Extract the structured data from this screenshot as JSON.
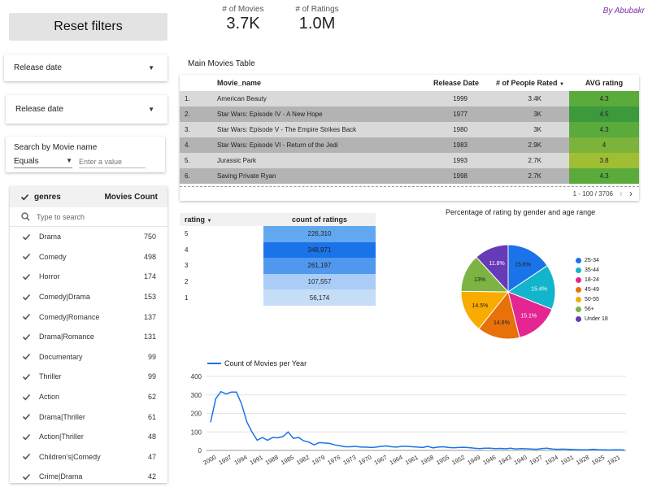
{
  "header": {
    "reset_label": "Reset filters",
    "author": "By Abubakr",
    "kpis": [
      {
        "label": "# of Movies",
        "value": "3.7K"
      },
      {
        "label": "# of Ratings",
        "value": "1.0M"
      }
    ]
  },
  "filters": {
    "release_date_1": "Release date",
    "release_date_2": "Release date",
    "search": {
      "title": "Search by Movie name",
      "operator": "Equals",
      "placeholder": "Enter a value"
    }
  },
  "genres": {
    "col_name": "genres",
    "col_count": "Movies Count",
    "search_placeholder": "Type to search",
    "items": [
      {
        "label": "Drama",
        "count": "750"
      },
      {
        "label": "Comedy",
        "count": "498"
      },
      {
        "label": "Horror",
        "count": "174"
      },
      {
        "label": "Comedy|Drama",
        "count": "153"
      },
      {
        "label": "Comedy|Romance",
        "count": "137"
      },
      {
        "label": "Drama|Romance",
        "count": "131"
      },
      {
        "label": "Documentary",
        "count": "99"
      },
      {
        "label": "Thriller",
        "count": "99"
      },
      {
        "label": "Action",
        "count": "62"
      },
      {
        "label": "Drama|Thriller",
        "count": "61"
      },
      {
        "label": "Action|Thriller",
        "count": "48"
      },
      {
        "label": "Children's|Comedy",
        "count": "47"
      },
      {
        "label": "Crime|Drama",
        "count": "42"
      }
    ]
  },
  "main_table": {
    "title": "Main Movies Table",
    "columns": [
      "Movie_name",
      "Release Date",
      "# of People Rated",
      "AVG rating"
    ],
    "rows": [
      {
        "idx": "1.",
        "name": "American Beauty",
        "year": "1999",
        "rated": "3.4K",
        "avg": "4.3",
        "color": "#5aaa3c"
      },
      {
        "idx": "2.",
        "name": "Star Wars: Episode IV - A New Hope",
        "year": "1977",
        "rated": "3K",
        "avg": "4.5",
        "color": "#3c9a3c"
      },
      {
        "idx": "3.",
        "name": "Star Wars: Episode V - The Empire Strikes Back",
        "year": "1980",
        "rated": "3K",
        "avg": "4.3",
        "color": "#5aaa3c"
      },
      {
        "idx": "4.",
        "name": "Star Wars: Episode VI - Return of the Jedi",
        "year": "1983",
        "rated": "2.9K",
        "avg": "4",
        "color": "#7cb33a"
      },
      {
        "idx": "5.",
        "name": "Jurassic Park",
        "year": "1993",
        "rated": "2.7K",
        "avg": "3.8",
        "color": "#9fbe33"
      },
      {
        "idx": "6.",
        "name": "Saving Private Ryan",
        "year": "1998",
        "rated": "2.7K",
        "avg": "4.3",
        "color": "#5aaa3c"
      }
    ],
    "pager": "1 - 100 / 3706"
  },
  "ratings_table": {
    "columns": [
      "rating",
      "count of ratings"
    ],
    "rows": [
      {
        "rating": "5",
        "count": "226,310",
        "color": "#62a8f0"
      },
      {
        "rating": "4",
        "count": "348,971",
        "color": "#1a73e8"
      },
      {
        "rating": "3",
        "count": "261,197",
        "color": "#4f98ee"
      },
      {
        "rating": "2",
        "count": "107,557",
        "color": "#a9cdf6"
      },
      {
        "rating": "1",
        "count": "56,174",
        "color": "#c6ddf8"
      }
    ]
  },
  "pie_chart": {
    "title": "Percentage of rating by gender and age range"
  },
  "line_chart": {
    "legend": "Count of Movies per Year"
  },
  "chart_data": [
    {
      "type": "pie",
      "title": "Percentage of rating by gender and age range",
      "labels": [
        "25-34",
        "35-44",
        "18-24",
        "45-49",
        "50-55",
        "56+",
        "Under 18"
      ],
      "values": [
        15.6,
        15.4,
        15.1,
        14.6,
        14.5,
        13,
        11.8
      ],
      "slice_labels": [
        "15.6%",
        "15.4%",
        "15.1%",
        "14.6%",
        "14.5%",
        "13%",
        "11.8%"
      ],
      "colors": [
        "#1a73e8",
        "#12b5cb",
        "#e52592",
        "#e8710a",
        "#f9ab00",
        "#7cb342",
        "#673ab7"
      ],
      "legend_position": "right"
    },
    {
      "type": "line",
      "series": [
        {
          "name": "Count of Movies per Year",
          "color": "#1a73e8",
          "values": [
            152,
            280,
            318,
            305,
            315,
            315,
            250,
            155,
            100,
            55,
            70,
            55,
            70,
            68,
            75,
            100,
            65,
            70,
            52,
            45,
            30,
            42,
            40,
            38,
            30,
            25,
            20,
            20,
            22,
            18,
            18,
            16,
            18,
            22,
            24,
            20,
            18,
            22,
            22,
            20,
            18,
            16,
            22,
            14,
            18,
            20,
            16,
            14,
            16,
            17,
            15,
            12,
            10,
            12,
            12,
            10,
            11,
            9,
            12,
            8,
            10,
            9,
            8,
            6,
            10,
            12,
            8,
            6,
            7,
            6,
            5,
            4,
            3,
            4,
            6,
            4,
            3,
            2,
            3,
            3,
            2
          ]
        }
      ],
      "x_start": 2000,
      "x_step": -1,
      "tick_labels": [
        "2000",
        "1997",
        "1994",
        "1991",
        "1988",
        "1985",
        "1982",
        "1979",
        "1976",
        "1973",
        "1970",
        "1967",
        "1964",
        "1961",
        "1958",
        "1955",
        "1952",
        "1949",
        "1946",
        "1943",
        "1940",
        "1937",
        "1934",
        "1931",
        "1928",
        "1925",
        "1921"
      ],
      "ylim": [
        0,
        400
      ],
      "yticks": [
        0,
        100,
        200,
        300,
        400
      ],
      "grid": true,
      "legend_position": "top-left"
    }
  ]
}
